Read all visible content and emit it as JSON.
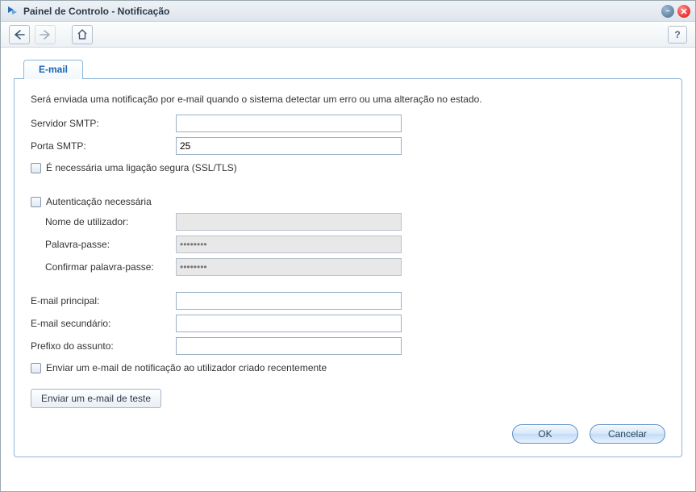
{
  "window": {
    "title": "Painel de Controlo - Notificação"
  },
  "tabs": {
    "email": "E-mail"
  },
  "description": "Será enviada uma notificação por e-mail quando o sistema detectar um erro ou uma alteração no estado.",
  "fields": {
    "smtp_server_label": "Servidor SMTP:",
    "smtp_server_value": "",
    "smtp_port_label": "Porta SMTP:",
    "smtp_port_value": "25",
    "ssl_checkbox_label": "É necessária uma ligação segura (SSL/TLS)",
    "auth_checkbox_label": "Autenticação necessária",
    "username_label": "Nome de utilizador:",
    "username_value": "",
    "password_label": "Palavra-passe:",
    "password_placeholder": "••••••••",
    "confirm_password_label": "Confirmar palavra-passe:",
    "confirm_password_placeholder": "••••••••",
    "primary_email_label": "E-mail principal:",
    "primary_email_value": "",
    "secondary_email_label": "E-mail secundário:",
    "secondary_email_value": "",
    "subject_prefix_label": "Prefixo do assunto:",
    "subject_prefix_value": "",
    "notify_new_user_label": "Enviar um e-mail de notificação ao utilizador criado recentemente"
  },
  "buttons": {
    "send_test": "Enviar um e-mail de teste",
    "ok": "OK",
    "cancel": "Cancelar",
    "help": "?"
  }
}
